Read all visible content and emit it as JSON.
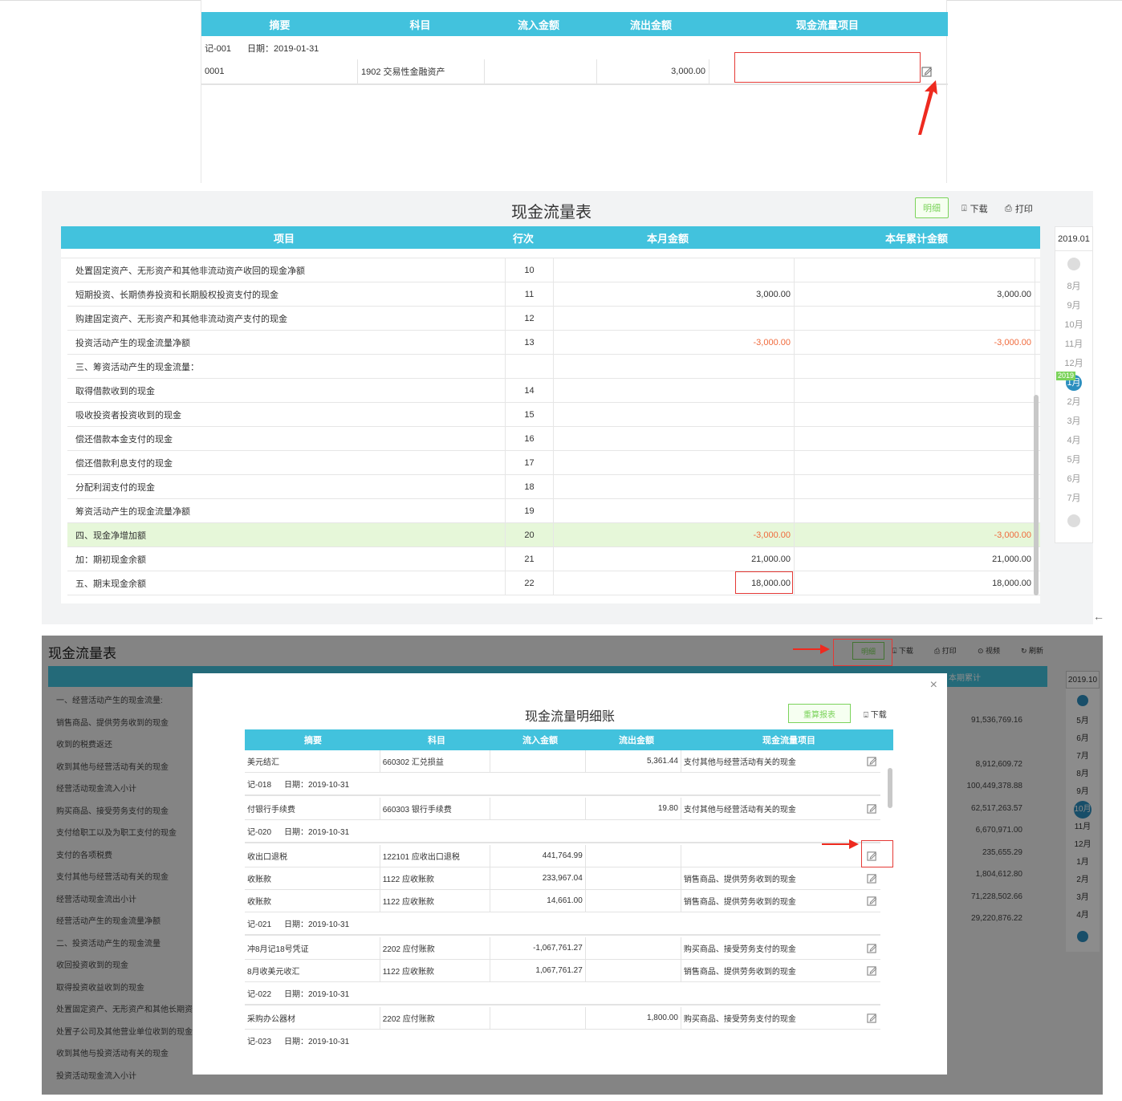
{
  "panel1": {
    "headers": [
      "摘要",
      "科目",
      "流入金额",
      "流出金额",
      "现金流量项目"
    ],
    "voucher_no": "记-001",
    "voucher_date": "日期：2019-01-31",
    "row": {
      "summary": "0001",
      "account": "1902 交易性金融资产",
      "inflow": "",
      "outflow": "3,000.00",
      "item": ""
    }
  },
  "panel2": {
    "title": "现金流量表",
    "btn_detail": "明细",
    "btn_download": "下载",
    "btn_print": "打印",
    "headers": [
      "项目",
      "行次",
      "本月金额",
      "本年累计金额"
    ],
    "rows": [
      {
        "name": "处置固定资产、无形资产和其他非流动资产收回的现金净额",
        "line": "10",
        "month": "",
        "year": "",
        "neg": false,
        "green": false
      },
      {
        "name": "短期投资、长期债券投资和长期股权投资支付的现金",
        "line": "11",
        "month": "3,000.00",
        "year": "3,000.00",
        "neg": false,
        "green": false
      },
      {
        "name": "购建固定资产、无形资产和其他非流动资产支付的现金",
        "line": "12",
        "month": "",
        "year": "",
        "neg": false,
        "green": false
      },
      {
        "name": "投资活动产生的现金流量净额",
        "line": "13",
        "month": "-3,000.00",
        "year": "-3,000.00",
        "neg": true,
        "green": false
      },
      {
        "name": "三、筹资活动产生的现金流量：",
        "line": "",
        "month": "",
        "year": "",
        "neg": false,
        "green": false
      },
      {
        "name": "取得借款收到的现金",
        "line": "14",
        "month": "",
        "year": "",
        "neg": false,
        "green": false
      },
      {
        "name": "吸收投资者投资收到的现金",
        "line": "15",
        "month": "",
        "year": "",
        "neg": false,
        "green": false
      },
      {
        "name": "偿还借款本金支付的现金",
        "line": "16",
        "month": "",
        "year": "",
        "neg": false,
        "green": false
      },
      {
        "name": "偿还借款利息支付的现金",
        "line": "17",
        "month": "",
        "year": "",
        "neg": false,
        "green": false
      },
      {
        "name": "分配利润支付的现金",
        "line": "18",
        "month": "",
        "year": "",
        "neg": false,
        "green": false
      },
      {
        "name": "筹资活动产生的现金流量净额",
        "line": "19",
        "month": "",
        "year": "",
        "neg": false,
        "green": false
      },
      {
        "name": "四、现金净增加额",
        "line": "20",
        "month": "-3,000.00",
        "year": "-3,000.00",
        "neg": true,
        "green": true
      },
      {
        "name": "加：期初现金余额",
        "line": "21",
        "month": "21,000.00",
        "year": "21,000.00",
        "neg": false,
        "green": false
      },
      {
        "name": "五、期末现金余额",
        "line": "22",
        "month": "18,000.00",
        "year": "18,000.00",
        "neg": false,
        "green": false
      }
    ],
    "side_year": "2019.01",
    "months": [
      "8月",
      "9月",
      "10月",
      "11月",
      "12月",
      "1月",
      "2月",
      "3月",
      "4月",
      "5月",
      "6月",
      "7月"
    ],
    "active_month_badge": "2019"
  },
  "panel3": {
    "bg_title": "现金流量表",
    "toolbar": [
      "明细",
      "下载",
      "打印",
      "视频",
      "刷新"
    ],
    "bg_header_right": "本期累计",
    "side_year": "2019.10",
    "months": [
      "5月",
      "6月",
      "7月",
      "8月",
      "9月",
      "10月",
      "11月",
      "12月",
      "1月",
      "2月",
      "3月",
      "4月"
    ],
    "bg_items": [
      "一、经营活动产生的现金流量:",
      "销售商品、提供劳务收到的现金",
      "收到的税费返还",
      "收到其他与经营活动有关的现金",
      "经营活动现金流入小计",
      "购买商品、接受劳务支付的现金",
      "支付给职工以及为职工支付的现金",
      "支付的各项税费",
      "支付其他与经营活动有关的现金",
      "经营活动现金流出小计",
      "经营活动产生的现金流量净额",
      "二、投资活动产生的现金流量",
      "收回投资收到的现金",
      "取得投资收益收到的现金",
      "处置固定资产、无形资产和其他长期资",
      "处置子公司及其他营业单位收到的现金",
      "收到其他与投资活动有关的现金",
      "投资活动现金流入小计"
    ],
    "bg_values": [
      "",
      "91,536,769.16",
      "",
      "8,912,609.72",
      "100,449,378.88",
      "62,517,263.57",
      "6,670,971.00",
      "235,655.29",
      "1,804,612.80",
      "71,228,502.66",
      "29,220,876.22"
    ],
    "modal": {
      "title": "现金流量明细账",
      "btn_recalc": "重算报表",
      "btn_download": "下载",
      "headers": [
        "摘要",
        "科目",
        "流入金额",
        "流出金额",
        "现金流量项目"
      ],
      "blocks": [
        {
          "voucher": "",
          "date": "",
          "rows": [
            {
              "summary": "美元结汇",
              "account": "660302 汇兑损益",
              "inflow": "",
              "outflow": "5,361.44",
              "item": "支付其他与经营活动有关的现金"
            }
          ]
        },
        {
          "voucher": "记-018",
          "date": "日期：2019-10-31",
          "rows": [
            {
              "summary": "付银行手续费",
              "account": "660303 银行手续费",
              "inflow": "",
              "outflow": "19.80",
              "item": "支付其他与经营活动有关的现金"
            }
          ]
        },
        {
          "voucher": "记-020",
          "date": "日期：2019-10-31",
          "rows": [
            {
              "summary": "收出口退税",
              "account": "122101 应收出口退税",
              "inflow": "441,764.99",
              "outflow": "",
              "item": ""
            },
            {
              "summary": "收账款",
              "account": "1122 应收账款",
              "inflow": "233,967.04",
              "outflow": "",
              "item": "销售商品、提供劳务收到的现金"
            },
            {
              "summary": "收账款",
              "account": "1122 应收账款",
              "inflow": "14,661.00",
              "outflow": "",
              "item": "销售商品、提供劳务收到的现金"
            }
          ]
        },
        {
          "voucher": "记-021",
          "date": "日期：2019-10-31",
          "rows": [
            {
              "summary": "冲8月记18号凭证",
              "account": "2202 应付账款",
              "inflow": "-1,067,761.27",
              "outflow": "",
              "item": "购买商品、接受劳务支付的现金"
            },
            {
              "summary": "8月收美元收汇",
              "account": "1122 应收账款",
              "inflow": "1,067,761.27",
              "outflow": "",
              "item": "销售商品、提供劳务收到的现金"
            }
          ]
        },
        {
          "voucher": "记-022",
          "date": "日期：2019-10-31",
          "rows": [
            {
              "summary": "采购办公器材",
              "account": "2202 应付账款",
              "inflow": "",
              "outflow": "1,800.00",
              "item": "购买商品、接受劳务支付的现金"
            }
          ]
        },
        {
          "voucher": "记-023",
          "date": "日期：2019-10-31",
          "rows": []
        }
      ]
    }
  },
  "colors": {
    "header": "#42c2dd",
    "green": "#7bd35b",
    "red": "#e53935",
    "negative": "#f06a3c"
  }
}
